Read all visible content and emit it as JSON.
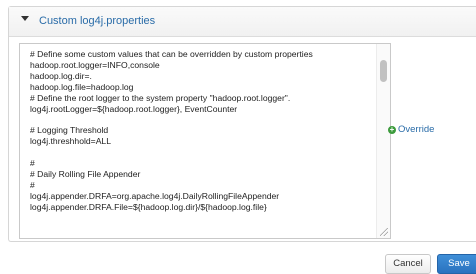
{
  "panel": {
    "title": "Custom log4j.properties"
  },
  "editor": {
    "lines": [
      "# Define some custom values that can be overridden by custom properties",
      "hadoop.root.logger=INFO,console",
      "hadoop.log.dir=.",
      "hadoop.log.file=hadoop.log",
      "# Define the root logger to the system property \"hadoop.root.logger\".",
      "log4j.rootLogger=${hadoop.root.logger}, EventCounter",
      "",
      "# Logging Threshold",
      "log4j.threshhold=ALL",
      "",
      "#",
      "# Daily Rolling File Appender",
      "#",
      "log4j.appender.DRFA=org.apache.log4j.DailyRollingFileAppender",
      "log4j.appender.DRFA.File=${hadoop.log.dir}/${hadoop.log.file}"
    ]
  },
  "override": {
    "label": "Override",
    "icon": "plus-circle-icon",
    "color": "#3c9b3c"
  },
  "actions": {
    "cancel_label": "Cancel",
    "save_label": "Save"
  },
  "colors": {
    "link": "#2a6ca8",
    "primary": "#2a72bf"
  }
}
